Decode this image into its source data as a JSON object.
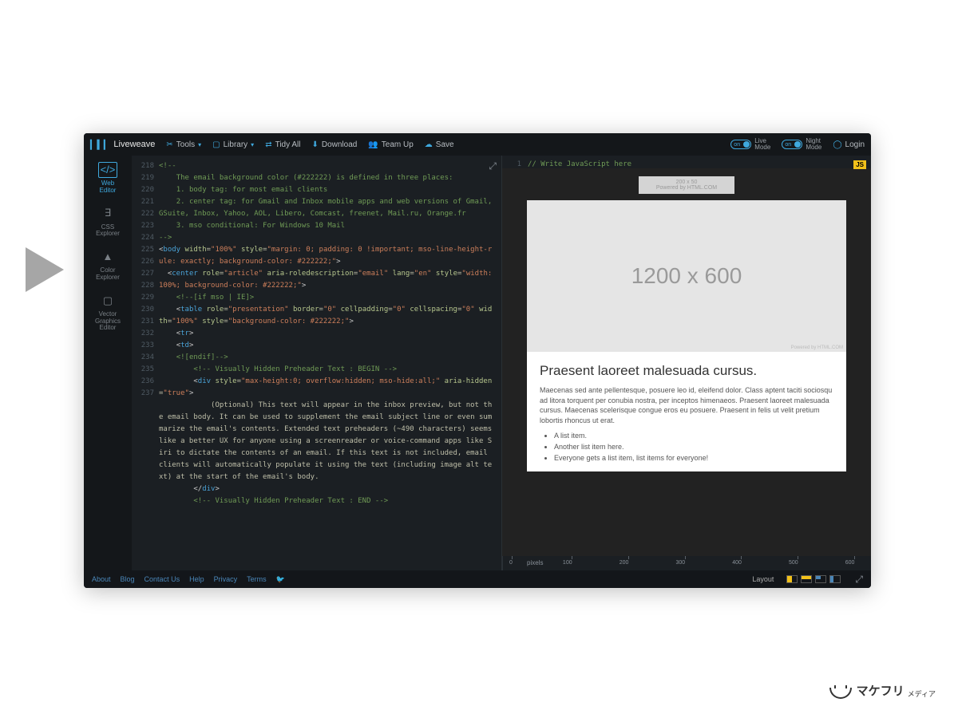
{
  "brand": "Liveweave",
  "toolbar": {
    "tools": "Tools",
    "library": "Library",
    "tidy": "Tidy All",
    "download": "Download",
    "teamup": "Team Up",
    "save": "Save",
    "live_mode": "Live\nMode",
    "night_mode": "Night\nMode",
    "toggle_on": "on",
    "login": "Login"
  },
  "sidebar": {
    "items": [
      {
        "label": "Web\nEditor",
        "icon": "</>"
      },
      {
        "label": "CSS\nExplorer",
        "icon": "∃"
      },
      {
        "label": "Color\nExplorer",
        "icon": "▲"
      },
      {
        "label": "Vector\nGraphics\nEditor",
        "icon": "▢"
      }
    ]
  },
  "code": {
    "lines": [
      {
        "n": 218,
        "t": "<!--",
        "cls": "c-comment"
      },
      {
        "n": 219,
        "t": "    The email background color (#222222) is defined in three places:",
        "cls": "c-comment"
      },
      {
        "n": 220,
        "t": "    1. body tag: for most email clients",
        "cls": "c-comment"
      },
      {
        "n": 221,
        "t": "    2. center tag: for Gmail and Inbox mobile apps and web versions of Gmail, GSuite, Inbox, Yahoo, AOL, Libero, Comcast, freenet, Mail.ru, Orange.fr",
        "cls": "c-comment"
      },
      {
        "n": 222,
        "t": "    3. mso conditional: For Windows 10 Mail",
        "cls": "c-comment"
      },
      {
        "n": 223,
        "t": "-->",
        "cls": "c-comment"
      },
      {
        "n": 224,
        "html": "<span class='c-punc'>&lt;</span><span class='c-tag'>body</span> <span class='c-attr'>width</span>=<span class='c-str'>\"100%\"</span> <span class='c-attr'>style</span>=<span class='c-str'>\"margin: 0; padding: 0 !important; mso-line-height-rule: exactly; background-color: #222222;\"</span><span class='c-punc'>&gt;</span>"
      },
      {
        "n": 225,
        "html": "  <span class='c-punc'>&lt;</span><span class='c-tag'>center</span> <span class='c-attr'>role</span>=<span class='c-str'>\"article\"</span> <span class='c-attr'>aria-roledescription</span>=<span class='c-str'>\"email\"</span> <span class='c-attr'>lang</span>=<span class='c-str'>\"en\"</span> <span class='c-attr'>style</span>=<span class='c-str'>\"width: 100%; background-color: #222222;\"</span><span class='c-punc'>&gt;</span>"
      },
      {
        "n": 226,
        "t": "    <!--[if mso | IE]>",
        "cls": "c-comment"
      },
      {
        "n": 227,
        "html": "    <span class='c-punc'>&lt;</span><span class='c-tag'>table</span> <span class='c-attr'>role</span>=<span class='c-str'>\"presentation\"</span> <span class='c-attr'>border</span>=<span class='c-str'>\"0\"</span> <span class='c-attr'>cellpadding</span>=<span class='c-str'>\"0\"</span> <span class='c-attr'>cellspacing</span>=<span class='c-str'>\"0\"</span> <span class='c-attr'>width</span>=<span class='c-str'>\"100%\"</span> <span class='c-attr'>style</span>=<span class='c-str'>\"background-color: #222222;\"</span><span class='c-punc'>&gt;</span>"
      },
      {
        "n": 228,
        "html": "    <span class='c-punc'>&lt;</span><span class='c-tag'>tr</span><span class='c-punc'>&gt;</span>"
      },
      {
        "n": 229,
        "html": "    <span class='c-punc'>&lt;</span><span class='c-tag'>td</span><span class='c-punc'>&gt;</span>"
      },
      {
        "n": 230,
        "t": "    <![endif]-->",
        "cls": "c-comment"
      },
      {
        "n": 231,
        "t": "",
        "cls": ""
      },
      {
        "n": 232,
        "t": "        <!-- Visually Hidden Preheader Text : BEGIN -->",
        "cls": "c-comment"
      },
      {
        "n": 233,
        "html": "        <span class='c-punc'>&lt;</span><span class='c-tag'>div</span> <span class='c-attr'>style</span>=<span class='c-str'>\"max-height:0; overflow:hidden; mso-hide:all;\"</span> <span class='c-attr'>aria-hidden</span>=<span class='c-str'>\"true\"</span><span class='c-punc'>&gt;</span>"
      },
      {
        "n": 234,
        "t": "            (Optional) This text will appear in the inbox preview, but not the email body. It can be used to supplement the email subject line or even summarize the email's contents. Extended text preheaders (~490 characters) seems like a better UX for anyone using a screenreader or voice-command apps like Siri to dictate the contents of an email. If this text is not included, email clients will automatically populate it using the text (including image alt text) at the start of the email's body.",
        "cls": ""
      },
      {
        "n": 235,
        "html": "        <span class='c-punc'>&lt;/</span><span class='c-tag'>div</span><span class='c-punc'>&gt;</span>"
      },
      {
        "n": 236,
        "t": "        <!-- Visually Hidden Preheader Text : END -->",
        "cls": "c-comment"
      },
      {
        "n": 237,
        "t": "",
        "cls": ""
      }
    ]
  },
  "js": {
    "line_no": "1",
    "comment": "// Write JavaScript here",
    "badge": "JS"
  },
  "preview": {
    "small_top": "200 x 50",
    "small_bottom": "Powered by HTML.COM",
    "hero_label": "1200 x 600",
    "hero_corner": "Powered by HTML.COM",
    "title": "Praesent laoreet malesuada cursus.",
    "paragraph": "Maecenas sed ante pellentesque, posuere leo id, eleifend dolor. Class aptent taciti sociosqu ad litora torquent per conubia nostra, per inceptos himenaeos. Praesent laoreet malesuada cursus. Maecenas scelerisque congue eros eu posuere. Praesent in felis ut velit pretium lobortis rhoncus ut erat.",
    "list": [
      "A list item.",
      "Another list item here.",
      "Everyone gets a list item, list items for everyone!"
    ]
  },
  "ruler": {
    "unit": "pixels",
    "ticks": [
      0,
      100,
      200,
      300,
      400,
      500,
      600
    ]
  },
  "footer": {
    "links": [
      "About",
      "Blog",
      "Contact Us",
      "Help",
      "Privacy",
      "Terms"
    ],
    "layout_label": "Layout"
  },
  "watermark": {
    "jp": "マケフリ",
    "sub": "メディア"
  }
}
